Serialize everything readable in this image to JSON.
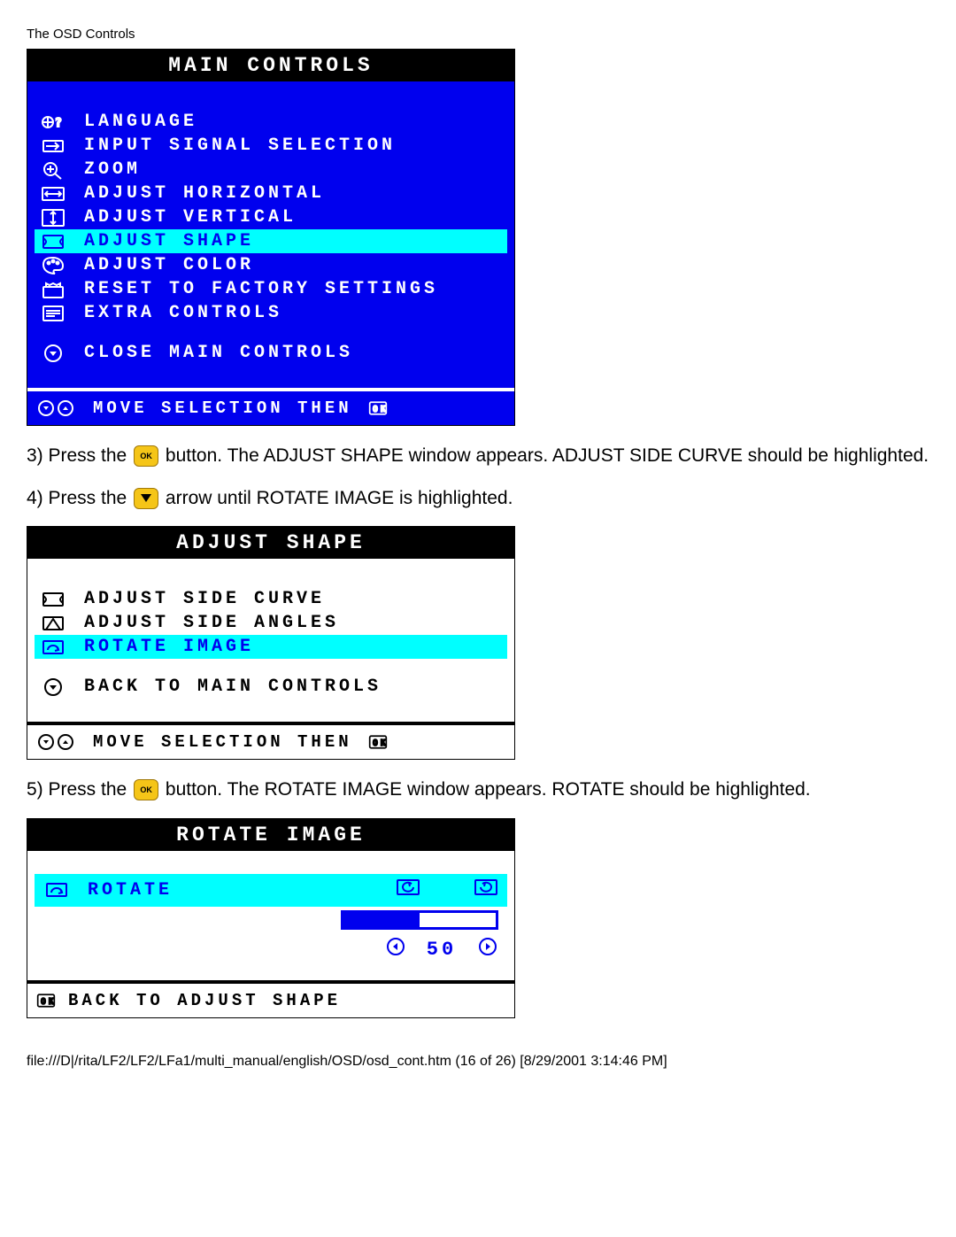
{
  "page_title": "The OSD Controls",
  "main_controls": {
    "header": "MAIN CONTROLS",
    "items": [
      {
        "label": "LANGUAGE"
      },
      {
        "label": "INPUT SIGNAL SELECTION"
      },
      {
        "label": "ZOOM"
      },
      {
        "label": "ADJUST HORIZONTAL"
      },
      {
        "label": "ADJUST VERTICAL"
      },
      {
        "label": "ADJUST SHAPE"
      },
      {
        "label": "ADJUST COLOR"
      },
      {
        "label": "RESET TO FACTORY SETTINGS"
      },
      {
        "label": "EXTRA CONTROLS"
      }
    ],
    "close_label": "CLOSE MAIN CONTROLS",
    "footer_label": "MOVE SELECTION THEN"
  },
  "instructions": {
    "step3_a": "3) Press the ",
    "step3_b": " button. The ADJUST SHAPE window appears. ADJUST SIDE CURVE should be highlighted.",
    "step4_a": "4) Press the ",
    "step4_b": " arrow until ROTATE IMAGE is highlighted.",
    "step5_a": "5) Press the ",
    "step5_b": " button. The ROTATE IMAGE window appears. ROTATE should be highlighted."
  },
  "adjust_shape": {
    "header": "ADJUST SHAPE",
    "items": [
      {
        "label": "ADJUST SIDE CURVE"
      },
      {
        "label": "ADJUST SIDE ANGLES"
      },
      {
        "label": "ROTATE IMAGE"
      }
    ],
    "back_label": "BACK TO MAIN CONTROLS",
    "footer_label": "MOVE SELECTION THEN"
  },
  "rotate_image": {
    "header": "ROTATE IMAGE",
    "rotate_label": "ROTATE",
    "value": "50",
    "back_label": "BACK TO ADJUST SHAPE"
  },
  "footer_path": "file:///D|/rita/LF2/LF2/LFa1/multi_manual/english/OSD/osd_cont.htm (16 of 26) [8/29/2001 3:14:46 PM]"
}
